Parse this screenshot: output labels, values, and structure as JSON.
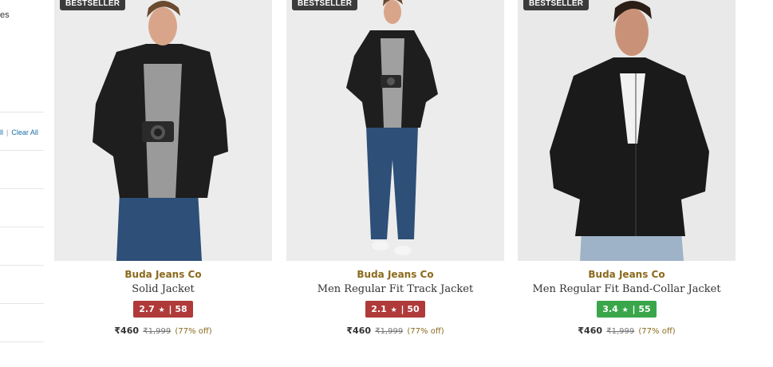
{
  "sidebar": {
    "partial_text": "es",
    "clear_all_partial": "ll",
    "clear_all": "Clear All"
  },
  "products": [
    {
      "badge": "BESTSELLER",
      "brand": "Buda Jeans Co",
      "name": "Solid Jacket",
      "rating": "2.7",
      "rating_count": "58",
      "rating_color": "#b03a3a",
      "price": "₹460",
      "mrp": "₹1,999",
      "discount": "(77% off)"
    },
    {
      "badge": "BESTSELLER",
      "brand": "Buda Jeans Co",
      "name": "Men Regular Fit Track Jacket",
      "rating": "2.1",
      "rating_count": "50",
      "rating_color": "#b03a3a",
      "price": "₹460",
      "mrp": "₹1,999",
      "discount": "(77% off)"
    },
    {
      "badge": "BESTSELLER",
      "brand": "Buda Jeans Co",
      "name": "Men Regular Fit Band-Collar Jacket",
      "rating": "3.4",
      "rating_count": "55",
      "rating_color": "#3aa64a",
      "price": "₹460",
      "mrp": "₹1,999",
      "discount": "(77% off)"
    }
  ]
}
